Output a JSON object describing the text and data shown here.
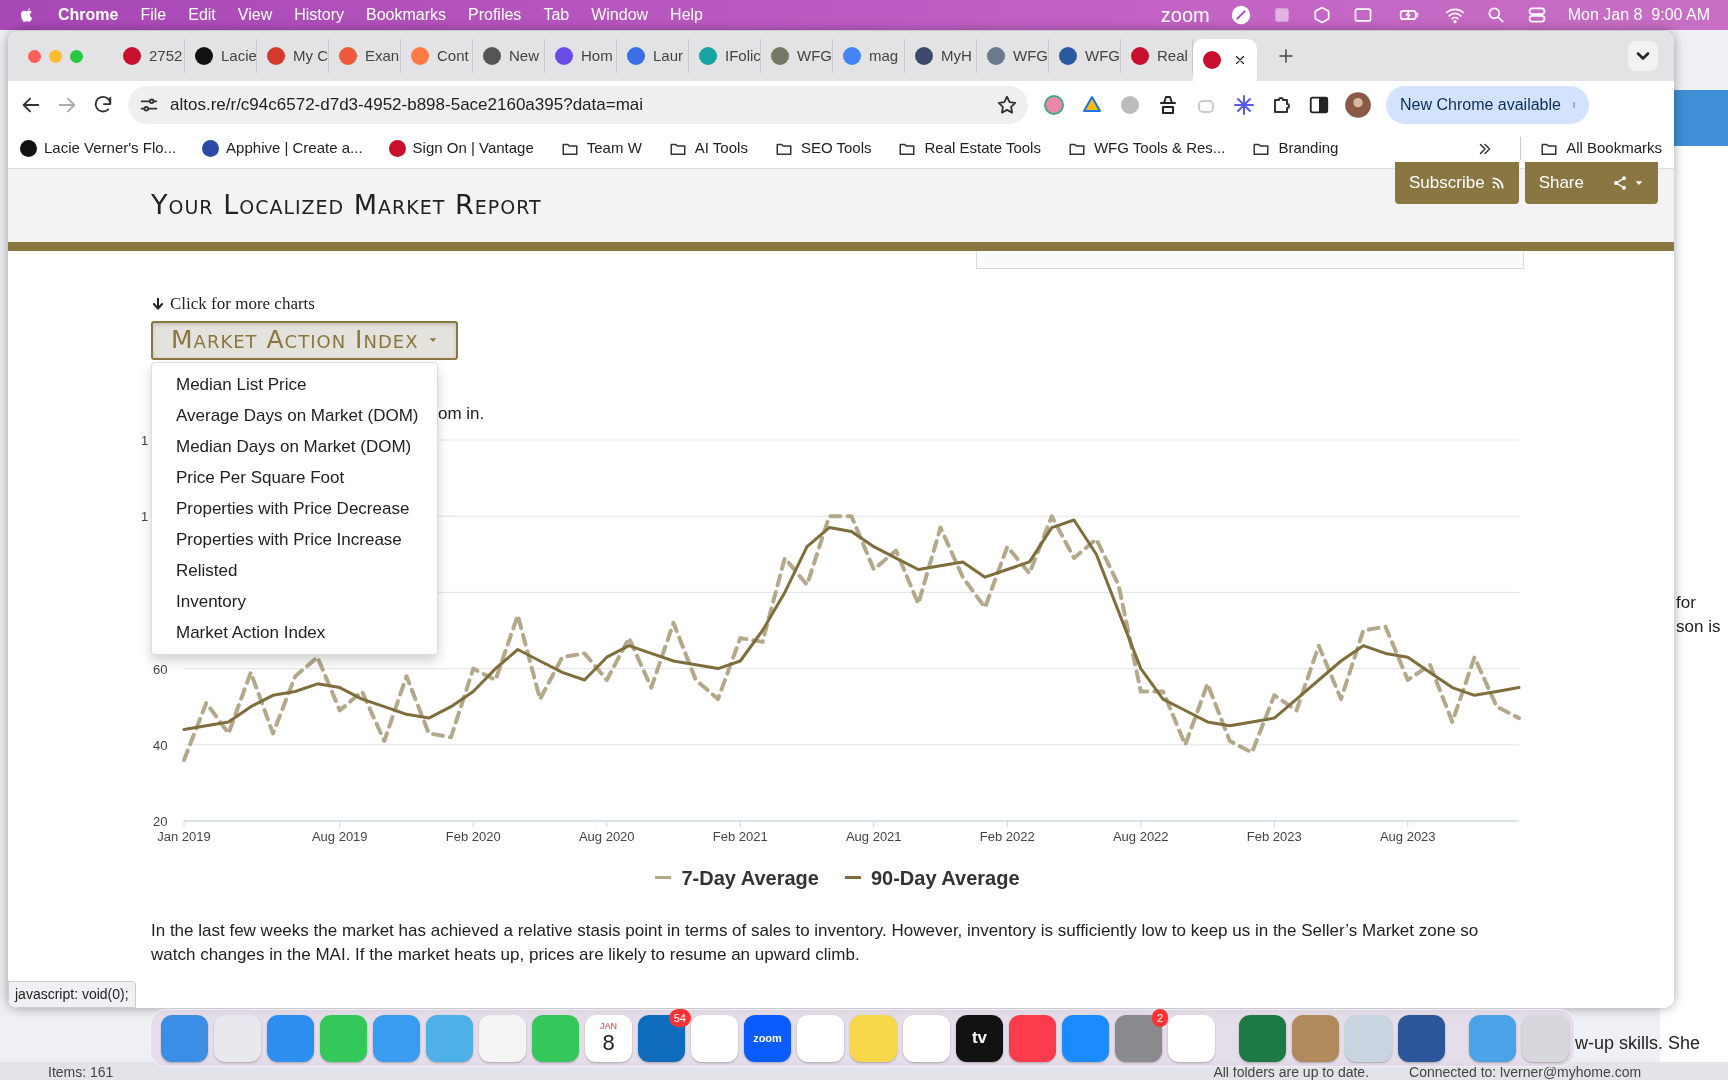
{
  "menu_bar": {
    "app": "Chrome",
    "menus": [
      "File",
      "Edit",
      "View",
      "History",
      "Bookmarks",
      "Profiles",
      "Tab",
      "Window",
      "Help"
    ],
    "zoom_label": "zoom",
    "clock": "Mon Jan 8  9:00 AM"
  },
  "browser": {
    "tabs": [
      {
        "title": "2752",
        "color": "#c8102e",
        "selected": false
      },
      {
        "title": "Lacie",
        "color": "#111111",
        "selected": false
      },
      {
        "title": "My C",
        "color": "#d33a2c",
        "selected": false
      },
      {
        "title": "Exan",
        "color": "#ee5a3c",
        "selected": false
      },
      {
        "title": "Cont",
        "color": "#ff7a45",
        "selected": false
      },
      {
        "title": "New",
        "color": "#555555",
        "selected": false
      },
      {
        "title": "Hom",
        "color": "#6b4ce6",
        "selected": false
      },
      {
        "title": "Laur",
        "color": "#3b6ee6",
        "selected": false
      },
      {
        "title": "IFolic",
        "color": "#1aa3a3",
        "selected": false
      },
      {
        "title": "WFG",
        "color": "#777766",
        "selected": false
      },
      {
        "title": "mag",
        "color": "#4285f4",
        "selected": false
      },
      {
        "title": "MyH",
        "color": "#3a4a6b",
        "selected": false
      },
      {
        "title": "WFG",
        "color": "#6a7a8a",
        "selected": false
      },
      {
        "title": "WFG",
        "color": "#2a5aa0",
        "selected": false
      },
      {
        "title": "Real",
        "color": "#c8102e",
        "selected": false
      },
      {
        "color": "#c8102e",
        "selected": true
      }
    ],
    "url": "altos.re/r/c94c6572-d7d3-4952-b898-5ace2160a395?data=mai",
    "update_button": "New Chrome available",
    "bookmarks": [
      {
        "kind": "site",
        "label": "Lacie Verner's Flo...",
        "color": "#111111"
      },
      {
        "kind": "site",
        "label": "Apphive | Create a...",
        "color": "#2b4aa8"
      },
      {
        "kind": "site",
        "label": "Sign On | Vantage",
        "color": "#c8102e"
      },
      {
        "kind": "folder",
        "label": "Team W"
      },
      {
        "kind": "folder",
        "label": "AI Tools"
      },
      {
        "kind": "folder",
        "label": "SEO Tools"
      },
      {
        "kind": "folder",
        "label": "Real Estate Tools"
      },
      {
        "kind": "folder",
        "label": "WFG Tools & Res..."
      },
      {
        "kind": "folder",
        "label": "Branding"
      }
    ],
    "all_bookmarks": "All Bookmarks"
  },
  "page": {
    "title": "Your Localized Market Report",
    "buttons": [
      {
        "label": "Subscribe",
        "kind": "rss"
      },
      {
        "label": "Share",
        "kind": "share"
      }
    ],
    "chart_hint": "Click for more charts",
    "chart_picker": {
      "label": "Market Action Index",
      "expanded": true,
      "options": [
        "Median List Price",
        "Average Days on Market (DOM)",
        "Median Days on Market (DOM)",
        "Price Per Square Foot",
        "Properties with Price Decrease",
        "Properties with Price Increase",
        "Relisted",
        "Inventory",
        "Market Action Index"
      ]
    },
    "covered_text": "om in.",
    "covered_axis_labels": [
      "1",
      "1"
    ],
    "chart_data": {
      "type": "line",
      "categories": [
        "Jan 2019",
        null,
        null,
        null,
        null,
        null,
        null,
        "Aug 2019",
        null,
        null,
        null,
        null,
        null,
        "Feb 2020",
        null,
        null,
        null,
        null,
        null,
        "Aug 2020",
        null,
        null,
        null,
        null,
        null,
        "Feb 2021",
        null,
        null,
        null,
        null,
        null,
        "Aug 2021",
        null,
        null,
        null,
        null,
        null,
        "Feb 2022",
        null,
        null,
        null,
        null,
        null,
        "Aug 2022",
        null,
        null,
        null,
        null,
        null,
        "Feb 2023",
        null,
        null,
        null,
        null,
        null,
        "Aug 2023",
        null,
        null,
        null,
        null,
        null
      ],
      "ylim": [
        20,
        120
      ],
      "yticks": [
        20,
        40,
        60
      ],
      "series": [
        {
          "name": "7-Day Average",
          "color": "#b3a98a",
          "line_style": "dashed",
          "values": [
            36,
            51,
            43,
            59,
            43,
            58,
            63,
            49,
            54,
            41,
            58,
            43,
            42,
            60,
            57,
            74,
            52,
            63,
            64,
            57,
            68,
            55,
            72,
            57,
            52,
            68,
            67,
            89,
            82,
            100,
            100,
            86,
            91,
            77,
            97,
            84,
            76,
            92,
            85,
            100,
            89,
            94,
            82,
            54,
            54,
            40,
            56,
            41,
            38,
            53,
            49,
            66,
            52,
            70,
            71,
            57,
            61,
            46,
            63,
            50,
            47
          ]
        },
        {
          "name": "90-Day Average",
          "color": "#7f6d3c",
          "line_style": "solid",
          "values": [
            44,
            45,
            46,
            50,
            53,
            54,
            56,
            55,
            52,
            50,
            48,
            47,
            50,
            54,
            60,
            65,
            62,
            59,
            57,
            63,
            66,
            64,
            62,
            61,
            60,
            62,
            70,
            80,
            92,
            97,
            96,
            92,
            89,
            86,
            87,
            88,
            84,
            86,
            88,
            97,
            99,
            90,
            75,
            60,
            52,
            49,
            46,
            45,
            46,
            47,
            52,
            57,
            62,
            66,
            64,
            63,
            59,
            55,
            53,
            54,
            55
          ]
        }
      ]
    },
    "summary": "In the last few weeks the market has achieved a relative stasis point in terms of sales to inventory. However, inventory is sufficiently low to keep us in the Seller’s Market zone so watch changes in the MAI. If the market heats up, prices are likely to resume an upward climb."
  },
  "status_link": "javascript: void(0);",
  "dock": [
    {
      "color": "#3a8ee6"
    },
    {
      "color": "#e8e8ee"
    },
    {
      "color": "#2b8ef0"
    },
    {
      "color": "#34c759"
    },
    {
      "color": "#3a9cf0"
    },
    {
      "color": "#4fb0e8"
    },
    {
      "color": "#f4f4f4"
    },
    {
      "color": "#34c759"
    },
    {
      "color": "#ffffff",
      "month": "JAN",
      "day": "8"
    },
    {
      "color": "#0f6cbd",
      "badge": "54"
    },
    {
      "color": "#ffffff"
    },
    {
      "color": "#0b5cff",
      "label": "zoom"
    },
    {
      "color": "#ffffff"
    },
    {
      "color": "#f7d84a"
    },
    {
      "color": "#ffffff"
    },
    {
      "color": "#111111",
      "label": "tv"
    },
    {
      "color": "#fa3c4c"
    },
    {
      "color": "#1a8cff"
    },
    {
      "color": "#8a8a8e",
      "badge": "2"
    },
    {
      "color": "#ffffff"
    },
    {
      "color": "#1d7a45"
    },
    {
      "color": "#b08a5a"
    },
    {
      "color": "#c8d4e0"
    },
    {
      "color": "#2b579a"
    },
    {
      "color": "#4aa3e8"
    },
    {
      "color": "#d8d8dc"
    }
  ],
  "background": {
    "texts": [
      "for",
      "son is"
    ],
    "snippet": "w-up skills. She",
    "status_bar": [
      "Items: 161",
      "All folders are up to date.",
      "Connected to: lverner@myhome.com"
    ]
  }
}
